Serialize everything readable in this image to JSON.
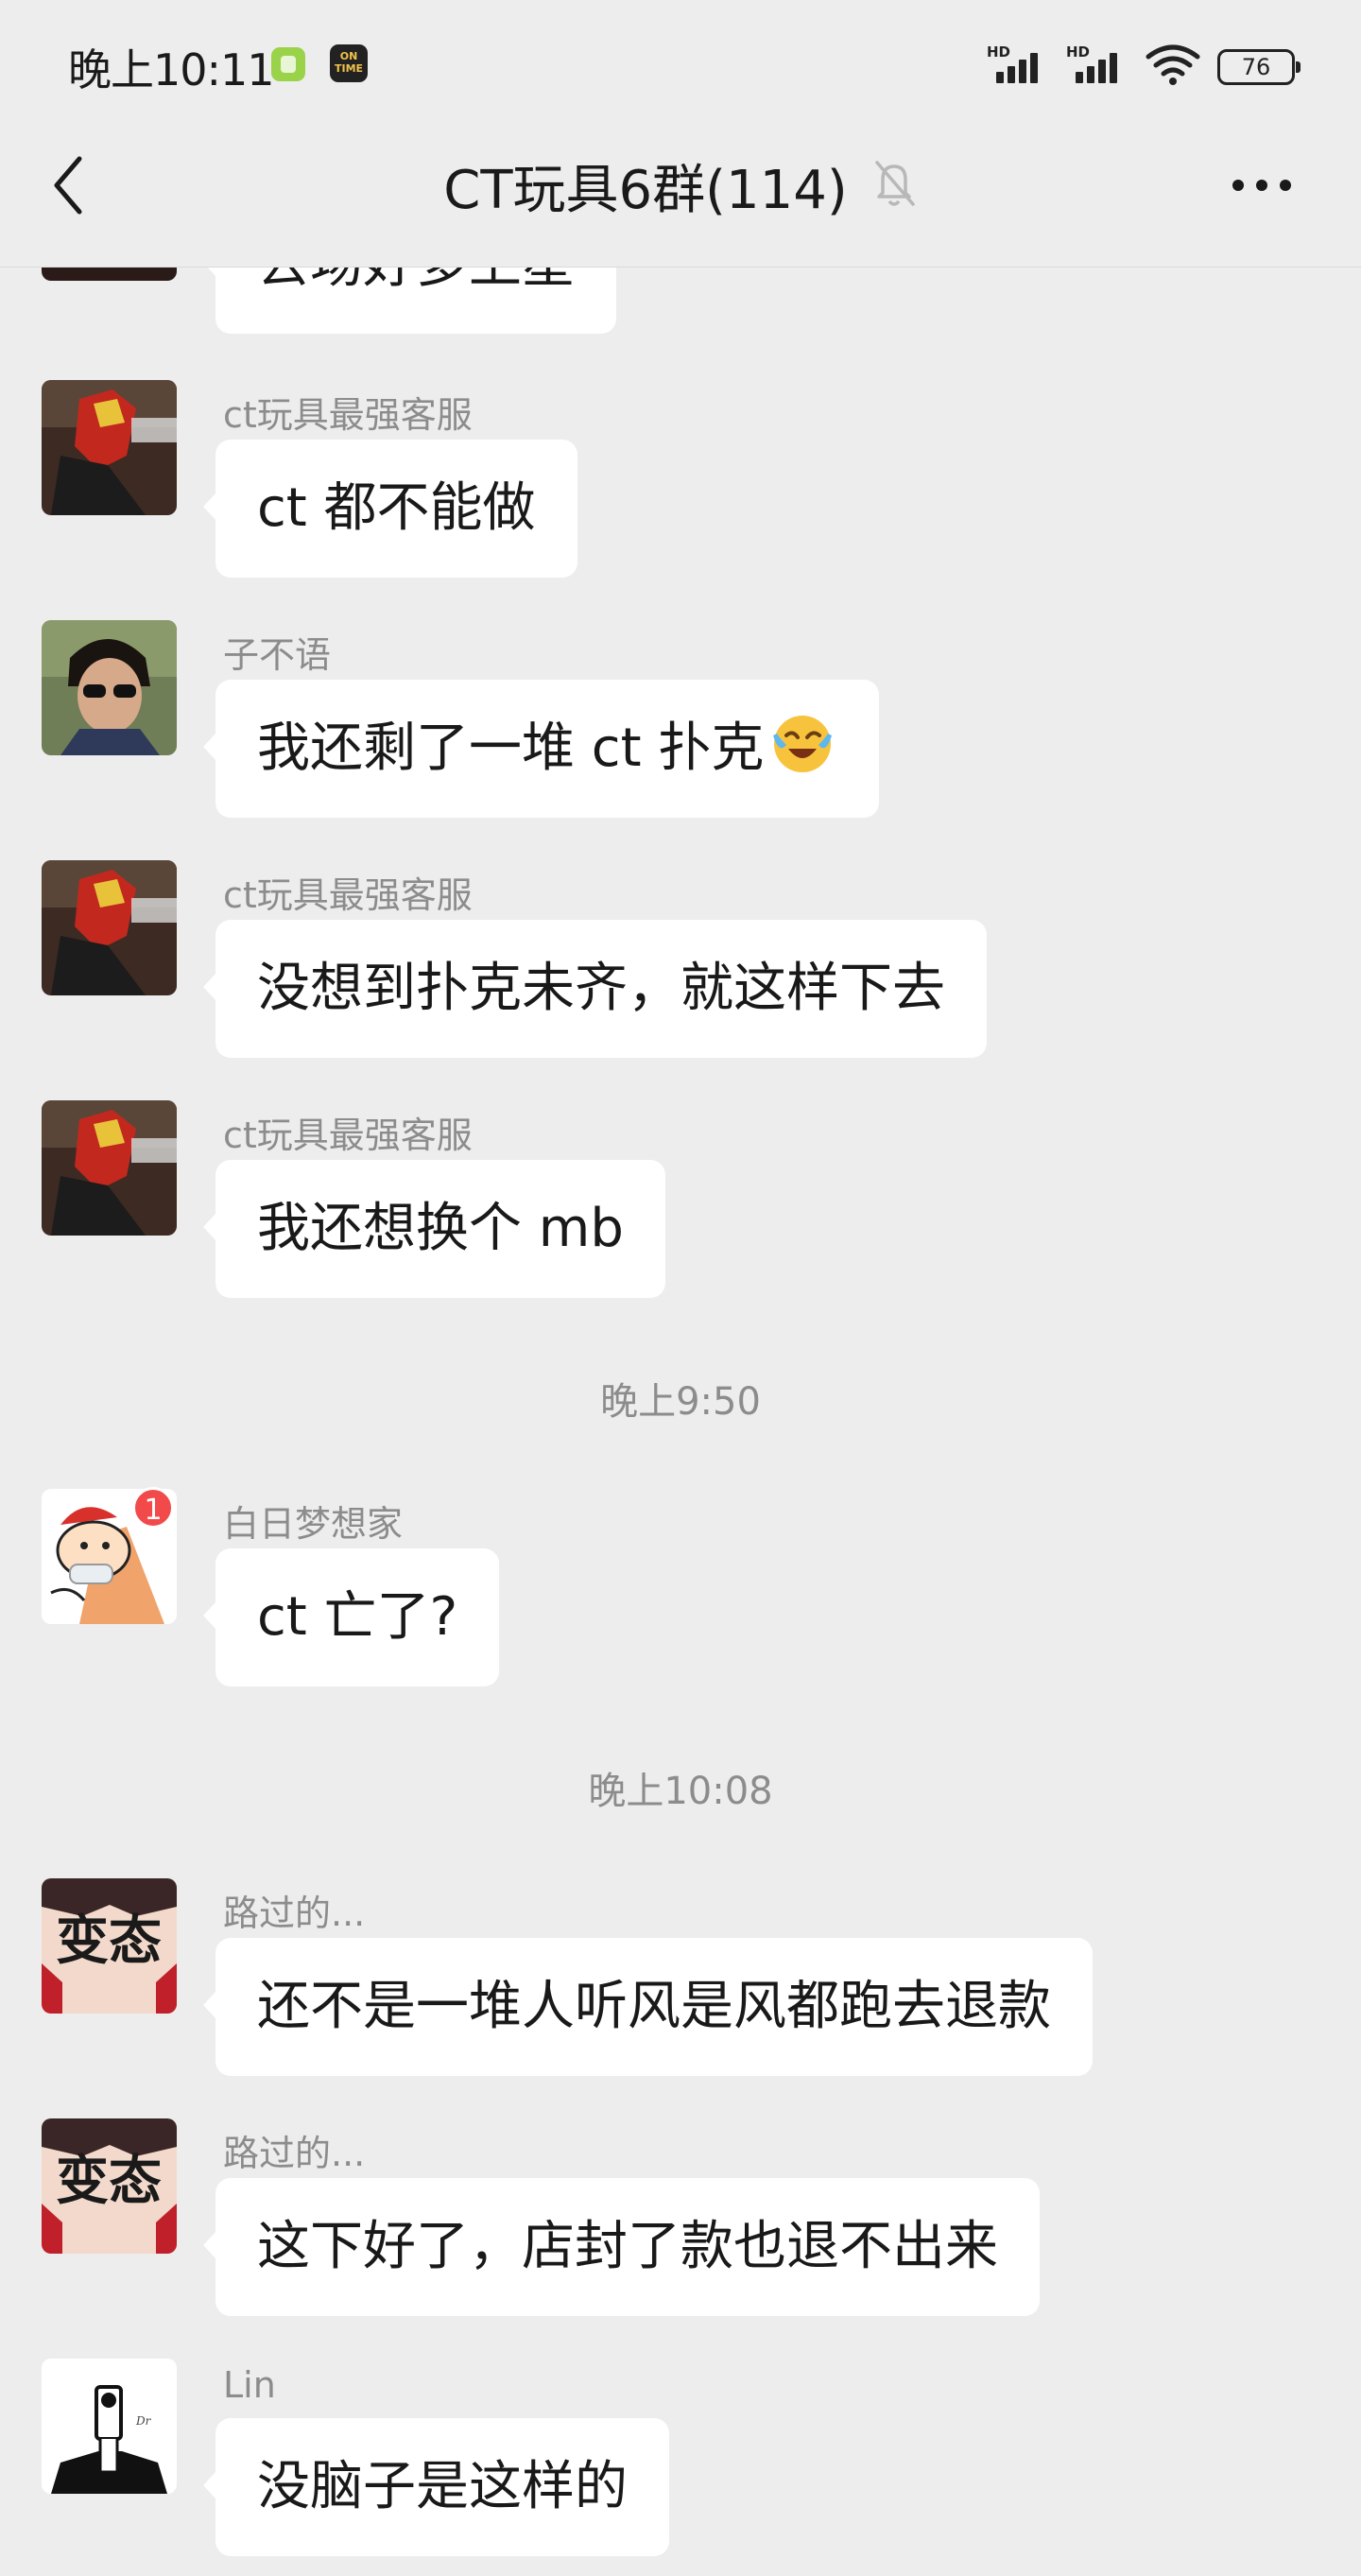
{
  "status_bar": {
    "time": "晚上10:11",
    "app_icon_2_text": "ON TIME",
    "signal_label_1": "HD",
    "signal_label_2": "HD",
    "battery": "76"
  },
  "header": {
    "title": "CT玩具6群(114)",
    "back_icon": "chevron-left-icon",
    "mute_icon": "bell-off-icon",
    "more_icon": "more-dots-icon"
  },
  "messages": [
    {
      "sender": "",
      "text": "去场好多上星",
      "partial": true
    },
    {
      "sender": "ct玩具最强客服",
      "text": "ct 都不能做"
    },
    {
      "sender": "子不语",
      "text": "我还剩了一堆 ct 扑克",
      "emoji": "laughing-crying-emoji"
    },
    {
      "sender": "ct玩具最强客服",
      "text": "没想到扑克未齐，就这样下去"
    },
    {
      "sender": "ct玩具最强客服",
      "text": "我还想换个 mb"
    },
    {
      "sender": "白日梦想家",
      "text": "ct 亡了?",
      "avatar_badge": "1"
    },
    {
      "sender": "路过的...",
      "text": "还不是一堆人听风是风都跑去退款"
    },
    {
      "sender": "路过的...",
      "text": "这下好了，店封了款也退不出来"
    },
    {
      "sender": "Lin",
      "text": "没脑子是这样的"
    }
  ],
  "timestamps": [
    "晚上9:50",
    "晚上10:08"
  ],
  "avatar_texts": {
    "biantai_1": "变态",
    "biantai_2": "变态"
  },
  "colors": {
    "background": "#ededed",
    "bubble": "#ffffff",
    "sender_name": "#8c8c8c",
    "badge": "#f24a4a"
  }
}
